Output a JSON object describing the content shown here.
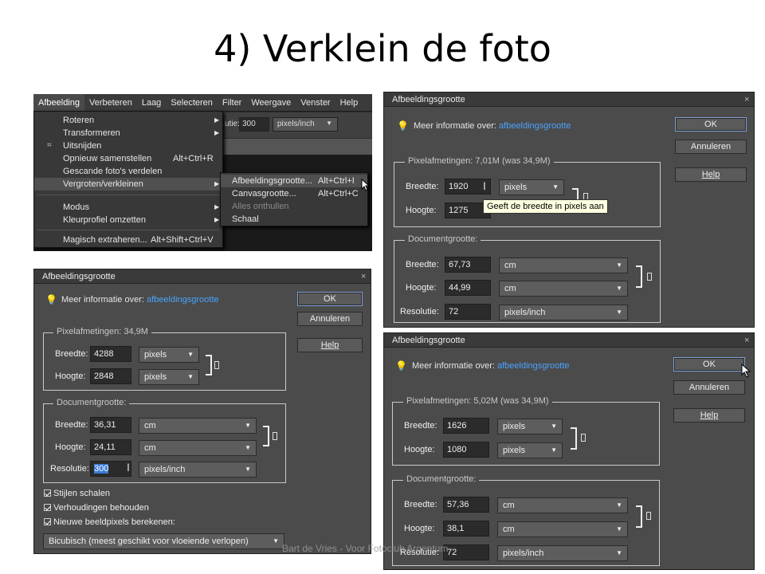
{
  "slide": {
    "title": "4) Verklein de foto",
    "footer": "Bart de Vries - Voor Fotoclub Argentum"
  },
  "menu_shot": {
    "menubar": [
      "Afbeelding",
      "Verbeteren",
      "Laag",
      "Selecteren",
      "Filter",
      "Weergave",
      "Venster",
      "Help"
    ],
    "options": {
      "label": "utie:",
      "value": "300",
      "unit": "pixels/inch"
    },
    "items": [
      {
        "label": "Roteren",
        "shortcut": ""
      },
      {
        "label": "Transformeren",
        "shortcut": ""
      },
      {
        "label": "Uitsnijden",
        "shortcut": ""
      },
      {
        "label": "Opnieuw samenstellen",
        "shortcut": "Alt+Ctrl+R"
      },
      {
        "label": "Gescande foto's verdelen",
        "shortcut": ""
      },
      {
        "label": "Vergroten/verkleinen",
        "shortcut": ""
      },
      {
        "label": "Modus",
        "shortcut": ""
      },
      {
        "label": "Kleurprofiel omzetten",
        "shortcut": ""
      },
      {
        "label": "Magisch extraheren...",
        "shortcut": "Alt+Shift+Ctrl+V"
      }
    ],
    "submenu": [
      {
        "label": "Afbeeldingsgrootte...",
        "shortcut": "Alt+Ctrl+I"
      },
      {
        "label": "Canvasgrootte...",
        "shortcut": "Alt+Ctrl+C"
      },
      {
        "label": "Alles onthullen",
        "shortcut": ""
      },
      {
        "label": "Schaal",
        "shortcut": ""
      }
    ]
  },
  "dialog_common": {
    "title": "Afbeeldingsgrootte",
    "close": "×",
    "info_prefix": "Meer informatie over:",
    "info_link": "afbeeldingsgrootte",
    "ok": "OK",
    "cancel": "Annuleren",
    "help": "Help",
    "pixel_group": "Pixelafmetingen:",
    "doc_group": "Documentgrootte:",
    "width_label": "Breedte:",
    "height_label": "Hoogte:",
    "resolution_label": "Resolutie:",
    "unit_pixels": "pixels",
    "unit_cm": "cm",
    "unit_ppi": "pixels/inch"
  },
  "dialog_a": {
    "pixel_size": "34,9M",
    "px_width": "4288",
    "px_height": "2848",
    "doc_width": "36,31",
    "doc_height": "24,11",
    "resolution": "300",
    "checks": [
      "Stijlen schalen",
      "Verhoudingen behouden",
      "Nieuwe beeldpixels berekenen:"
    ],
    "resample": "Bicubisch (meest geschikt voor vloeiende verlopen)"
  },
  "dialog_b": {
    "pixel_size": "7,01M (was 34,9M)",
    "px_width": "1920",
    "px_height": "1275",
    "doc_width": "67,73",
    "doc_height": "44,99",
    "resolution": "72",
    "tooltip": "Geeft de breedte in pixels aan"
  },
  "dialog_c": {
    "pixel_size": "5,02M (was 34,9M)",
    "px_width": "1626",
    "px_height": "1080",
    "doc_width": "57,36",
    "doc_height": "38,1",
    "resolution": "72"
  }
}
